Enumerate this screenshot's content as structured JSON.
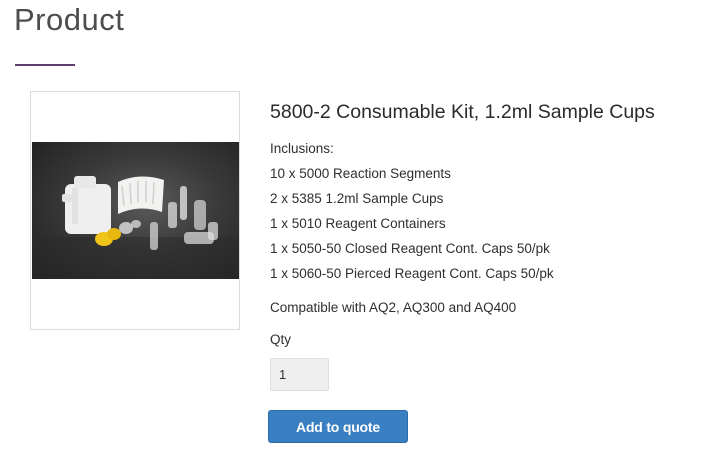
{
  "page": {
    "title": "Product"
  },
  "product": {
    "name": "5800-2 Consumable Kit, 1.2ml Sample Cups",
    "inclusions_heading": "Inclusions:",
    "inclusions": [
      "10 x 5000 Reaction Segments",
      "2 x 5385 1.2ml Sample Cups",
      "1 x 5010 Reagent Containers",
      "1 x 5050-50 Closed Reagent Cont. Caps 50/pk",
      "1 x 5060-50 Pierced Reagent Cont. Caps 50/pk"
    ],
    "compatibility": "Compatible with AQ2, AQ300 and AQ400"
  },
  "quote_form": {
    "qty_label": "Qty",
    "qty_value": "1",
    "add_button_label": "Add to quote"
  },
  "colors": {
    "accent_underline": "#5c3d6e",
    "button": "#3a7fc1"
  }
}
